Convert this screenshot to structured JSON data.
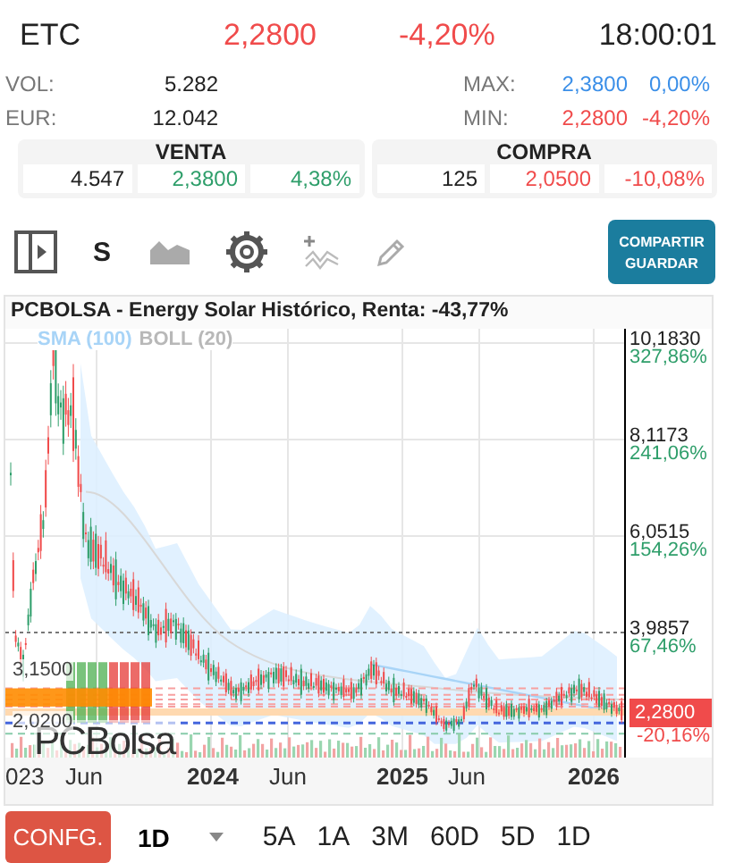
{
  "header": {
    "symbol": "ETC",
    "price": "2,2800",
    "change": "-4,20%",
    "time": "18:00:01"
  },
  "stats_left": [
    {
      "label": "VOL:",
      "value": "5.282"
    },
    {
      "label": "EUR:",
      "value": "12.042"
    }
  ],
  "stats_right": [
    {
      "label": "MAX:",
      "value": "2,3800",
      "change": "0,00%",
      "color": "#3b8fe8"
    },
    {
      "label": "MIN:",
      "value": "2,2800",
      "change": "-4,20%",
      "color": "#f04b4b"
    }
  ],
  "order_book": [
    {
      "title": "VENTA",
      "quantity": "4.547",
      "price": "2,3800",
      "change": "4,38%",
      "color": "#2e9e6a"
    },
    {
      "title": "COMPRA",
      "quantity": "125",
      "price": "2,0500",
      "change": "-10,08%",
      "color": "#f04b4b"
    }
  ],
  "toolbar": {
    "series_label": "S",
    "share_lines": [
      "COMPARTIR",
      "GUARDAR"
    ]
  },
  "chart": {
    "title": "PCBOLSA - Energy Solar Histórico, Renta: -43,77%",
    "indicators": [
      {
        "label": "SMA (100)",
        "color": "#a8d4f7"
      },
      {
        "label": "BOLL (20)",
        "color": "#b8b8b8"
      }
    ],
    "logo": "PCBolsa",
    "y_labels": [
      {
        "price": "10,1830",
        "change": "327,86%"
      },
      {
        "price": "8,1173",
        "change": "241,06%"
      },
      {
        "price": "6,0515",
        "change": "154,26%"
      },
      {
        "price": "3,9857",
        "change": "67,46%"
      }
    ],
    "current": {
      "price": "2,2800",
      "change": "-20,16%"
    },
    "level_labels": [
      "3,1500",
      "2,0200"
    ],
    "x_labels": [
      "023",
      "Jun",
      "2024",
      "Jun",
      "2025",
      "Jun",
      "2026"
    ]
  },
  "controls": {
    "config": "CONFG.",
    "interval": "1D",
    "ranges": [
      "5A",
      "1A",
      "3M",
      "60D",
      "5D",
      "1D"
    ]
  }
}
